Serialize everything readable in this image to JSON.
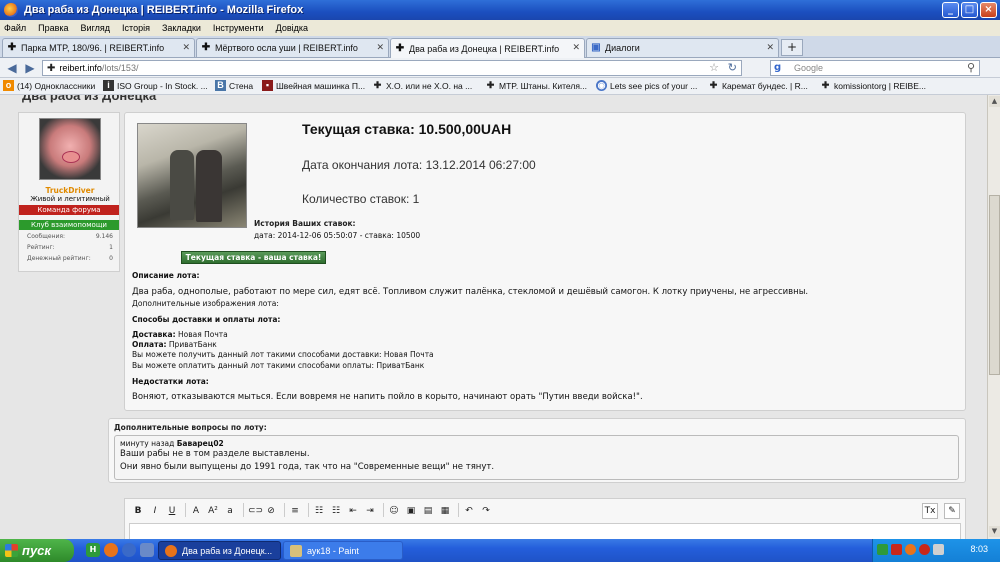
{
  "window": {
    "title": "Два раба из Донецка | REIBERT.info - Mozilla Firefox",
    "min": "_",
    "max": "□",
    "close": "×"
  },
  "menu": [
    "Файл",
    "Правка",
    "Вигляд",
    "Історія",
    "Закладки",
    "Інструменти",
    "Довідка"
  ],
  "tabs": [
    {
      "label": "Парка MTP, 180/96. | REIBERT.info",
      "icon": "✚",
      "active": false
    },
    {
      "label": "Мёртвого осла уши | REIBERT.info",
      "icon": "✚",
      "active": false
    },
    {
      "label": "Два раба из Донецка | REIBERT.info",
      "icon": "✚",
      "active": true
    },
    {
      "label": "Диалоги",
      "icon": "▣",
      "active": false
    }
  ],
  "newtab": "+",
  "nav": {
    "url_domain": "reibert.info",
    "url_path": "/lots/153/",
    "search_placeholder": "Google",
    "back": "◀",
    "forward": "▶",
    "star": "☆",
    "reload": "↻",
    "search_icon": "⚲"
  },
  "bookmarks": [
    {
      "label": "(14) Одноклассники",
      "icon": "ok",
      "color": "#f08a00"
    },
    {
      "label": "ISO Group - In Stock. ...",
      "icon": "iso",
      "color": "#333333"
    },
    {
      "label": "Стена",
      "icon": "vk",
      "color": "#4a76a8"
    },
    {
      "label": "Швейная машинка П...",
      "icon": "sew",
      "color": "#8a1a1a"
    },
    {
      "label": "Х.О. или не Х.О. на ...",
      "icon": "plus",
      "color": "#222222"
    },
    {
      "label": "MTP. Штаны. Кителя...",
      "icon": "plus",
      "color": "#222222"
    },
    {
      "label": "Lets see pics of your ...",
      "icon": "globe",
      "color": "#4a76c8"
    },
    {
      "label": "Каремат бундес. | R...",
      "icon": "plus",
      "color": "#222222"
    },
    {
      "label": "komissiontorg | REIBE...",
      "icon": "plus",
      "color": "#222222"
    }
  ],
  "page": {
    "heading": "Два раба из Донецка"
  },
  "user": {
    "name": "TruckDriver",
    "title": "Живой и легитимный",
    "role1": "Команда форума",
    "role2": "Клуб взаимопомощи",
    "stats": [
      {
        "label": "Сообщения:",
        "value": "9.146"
      },
      {
        "label": "Рейтинг:",
        "value": "1"
      },
      {
        "label": "Денежный рейтинг:",
        "value": "0"
      }
    ]
  },
  "lot": {
    "current_bid": "Текущая ставка: 10.500,00UAH",
    "end_date": "Дата окончания лота: 13.12.2014 06:27:00",
    "bid_count": "Количество ставок: 1",
    "history_title": "История Ваших ставок:",
    "history_line": "дата: 2014-12-06 05:50:07 - ставка: 10500",
    "bid_button": "Текущая ставка - ваша ставка!",
    "desc_title": "Описание лота:",
    "desc_text": "Два раба, однополые, работают по мере сил, едят всё. Топливом служит палёнка, стекломой и дешёвый самогон. К лотку приучены, не агрессивны.",
    "extra_images": "Дополнительные изображения лота:",
    "delivery_title": "Способы доставки и оплаты лота:",
    "delivery_label": "Доставка:",
    "delivery_value": " Новая Почта",
    "payment_label": "Оплата:",
    "payment_value": " ПриватБанк",
    "delivery_note": "Вы можете получить данный лот такими способами доставки: Новая Почта",
    "payment_note": "Вы можете оплатить данный лот такими способами оплаты: ПриватБанк",
    "defects_title": "Недостатки лота:",
    "defects_text": "Воняют, отказываются мыться. Если вовремя не напить пойло в корыто, начинают орать \"Путин введи войска!\"."
  },
  "questions": {
    "title": "Дополнительные вопросы по лоту:",
    "meta_time": "минуту назад ",
    "meta_user": "Баварец02",
    "line1": "Ваши рабы не в том разделе выставлены.",
    "line2": "Они явно были выпущены до 1991 года, так что на \"Современные вещи\" не тянут."
  },
  "editor": {
    "tools": [
      "B",
      "I",
      "U",
      "A",
      "A²",
      "a",
      "⊂⊃",
      "⊘",
      "≡",
      "☷",
      "☷",
      "⇤",
      "⇥",
      "☺",
      "▣",
      "▤",
      "▦",
      "↶",
      "↷"
    ],
    "clear": "Tx",
    "mode": "✎"
  },
  "taskbar": {
    "start": "пуск",
    "tasks": [
      {
        "label": "Два раба из Донецк...",
        "active": true
      },
      {
        "label": "аук18 - Paint",
        "active": false
      }
    ],
    "time": "8:03"
  }
}
